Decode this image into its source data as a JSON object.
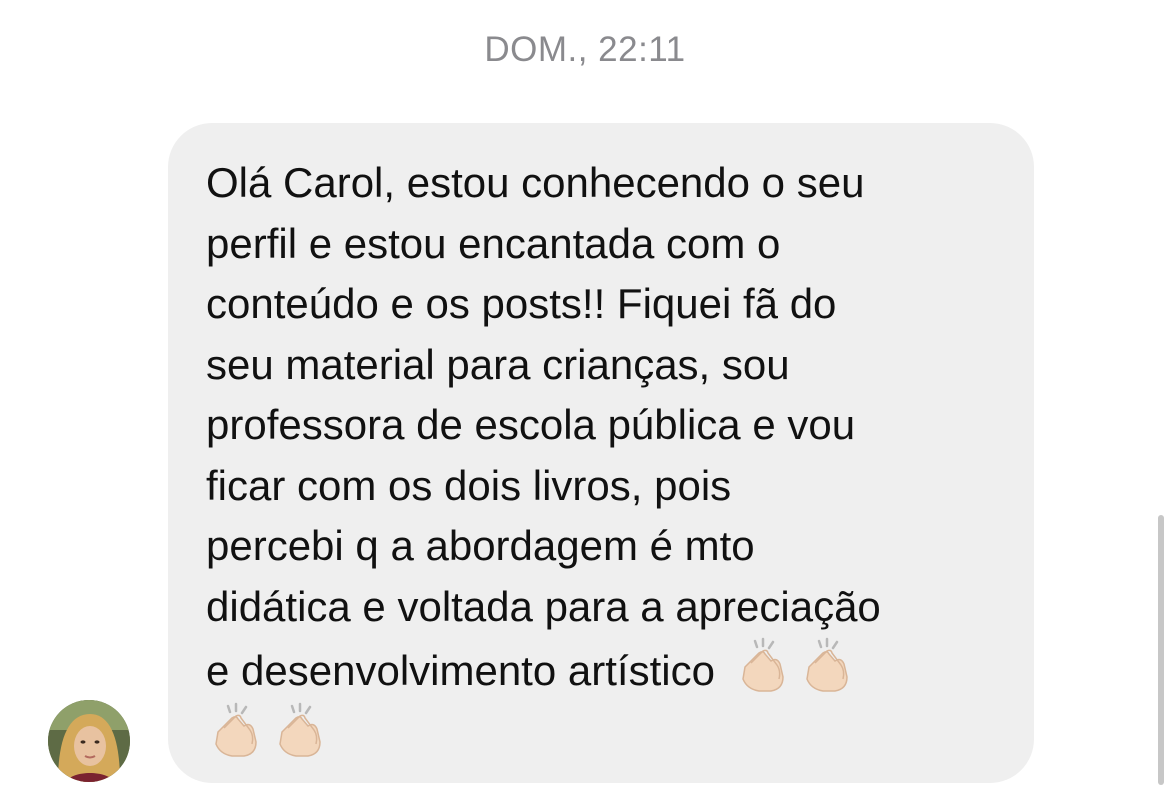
{
  "conversation": {
    "timestamp": "DOM., 22:11",
    "message": {
      "lines": [
        "Olá Carol, estou conhecendo o seu",
        "perfil e estou encantada com o",
        "conteúdo e os posts!! Fiquei fã do",
        "seu material para crianças, sou",
        "professora de escola pública e vou",
        "ficar com os dois livros, pois",
        "percebi q a abordagem é mto",
        "didática e voltada para a apreciação",
        "e desenvolvimento artístico"
      ],
      "emojis": [
        "clapping-hands",
        "clapping-hands",
        "clapping-hands",
        "clapping-hands"
      ]
    },
    "sender": {
      "avatar_icon": "profile-photo"
    }
  },
  "colors": {
    "bubble_bg": "#efefef",
    "timestamp": "#8a8a8e",
    "text": "#111111"
  }
}
